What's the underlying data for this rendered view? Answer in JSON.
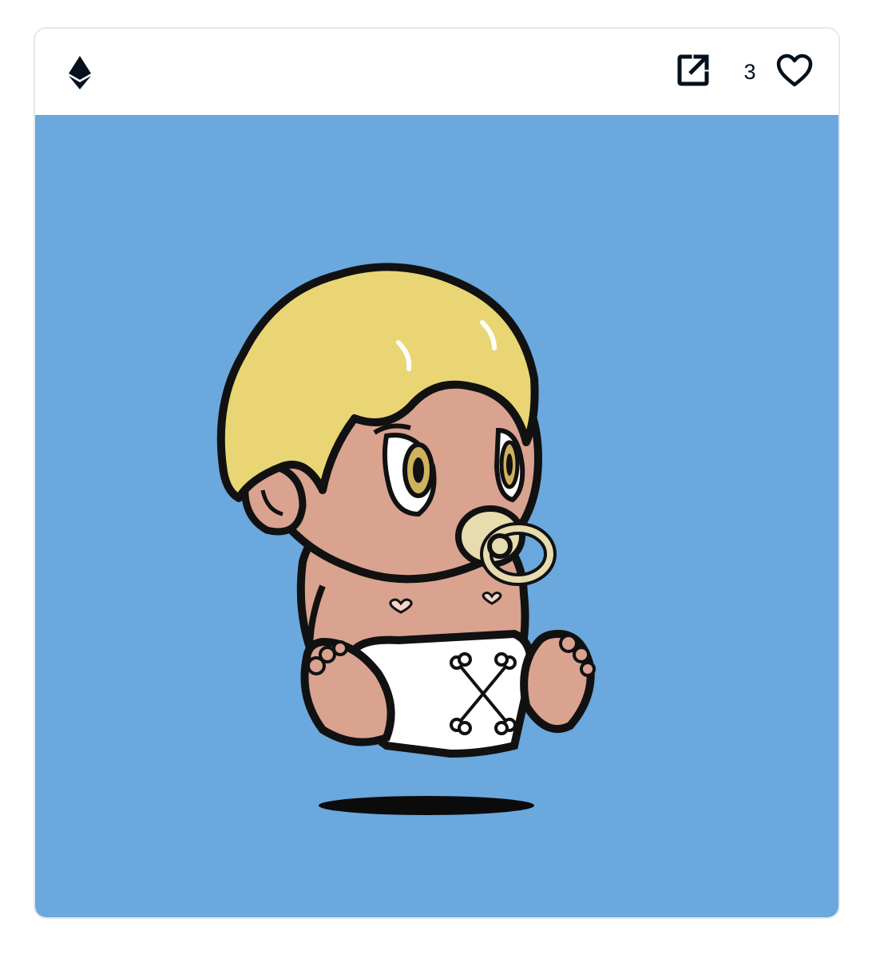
{
  "header": {
    "chain_icon": "ethereum-icon",
    "external_link_icon": "external-link-icon",
    "favorite_icon": "heart-outline-icon",
    "favorite_count": "3"
  },
  "media": {
    "subject": "cartoon-baby-nft-artwork",
    "background_color": "#6aa8dd"
  },
  "colors": {
    "text": "#04111d",
    "border": "#e5e8eb",
    "hair": "#e9d574",
    "skin": "#d9a390",
    "pacifier": "#e6dcae",
    "diaper": "#ffffff"
  }
}
